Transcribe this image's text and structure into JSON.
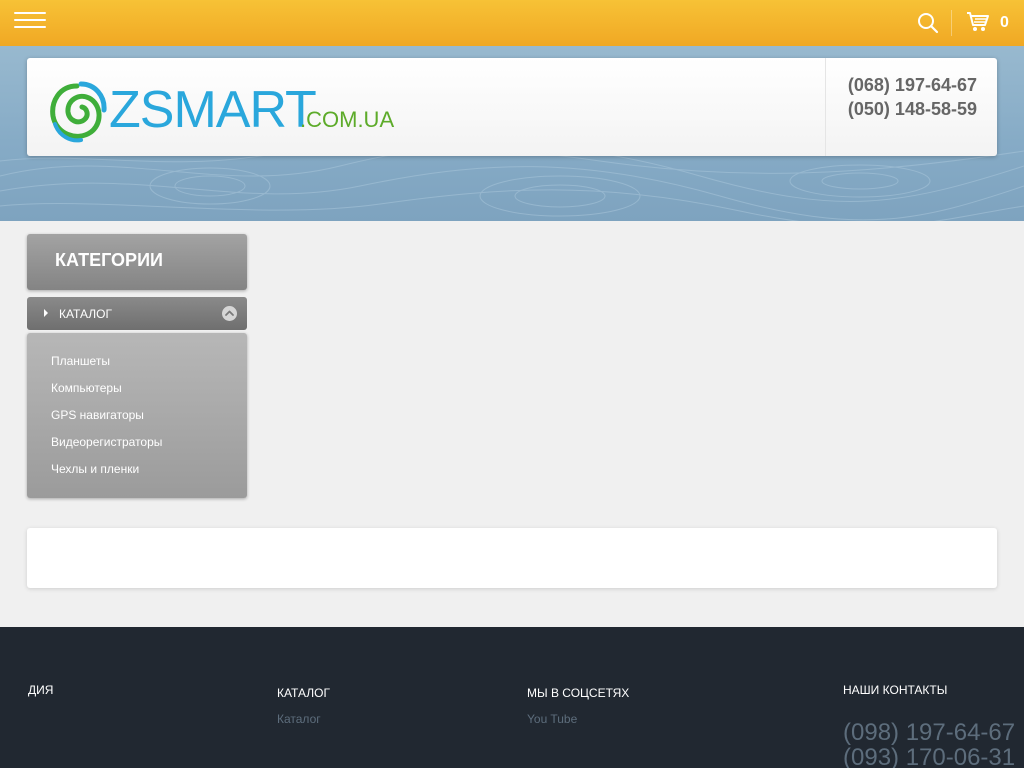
{
  "topbar": {
    "menu_icon": "hamburger-menu-icon",
    "search_icon": "search-icon",
    "cart_icon": "cart-icon",
    "cart_count": "0",
    "accent_color": "#f4b52e"
  },
  "header": {
    "logo_word": "ZSMART",
    "logo_domain": ".COM.UA",
    "phones": [
      "(068) 197-64-67",
      "(050) 148-58-59"
    ]
  },
  "sidebar": {
    "title": "КАТЕГОРИИ",
    "catalog_label": "КАТАЛОГ",
    "items": [
      "Планшеты",
      "Компьютеры",
      "GPS навигаторы",
      "Видеорегистраторы",
      "Чехлы и пленки"
    ]
  },
  "footer": {
    "col1_heading": "ДИЯ",
    "catalog_heading": "КАТАЛОГ",
    "catalog_link": "Каталог",
    "social_heading": "МЫ В СОЦСЕТЯХ",
    "social_link": "You Tube",
    "contacts_heading": "НАШИ КОНТАКТЫ",
    "phones": [
      "(098) 197-64-67",
      "(093) 170-06-31"
    ],
    "background_color": "#212831"
  }
}
